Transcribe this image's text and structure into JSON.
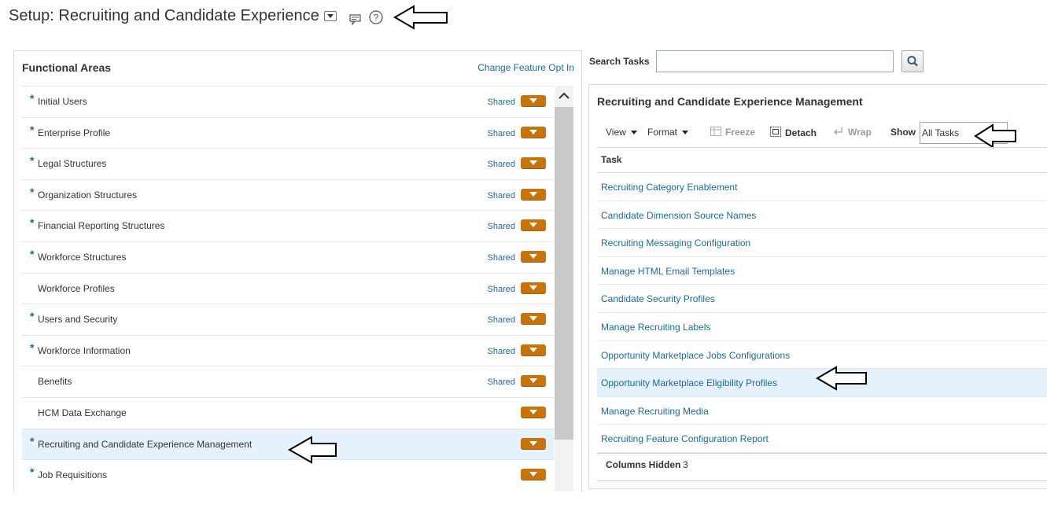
{
  "page": {
    "title": "Setup: Recruiting and Candidate Experience"
  },
  "functional_areas": {
    "heading": "Functional Areas",
    "change_feature_link": "Change Feature Opt In",
    "items": [
      {
        "label": "Initial Users",
        "required": "*",
        "shared": "Shared"
      },
      {
        "label": "Enterprise Profile",
        "required": "*",
        "shared": "Shared"
      },
      {
        "label": "Legal Structures",
        "required": "*",
        "shared": "Shared"
      },
      {
        "label": "Organization Structures",
        "required": "*",
        "shared": "Shared"
      },
      {
        "label": "Financial Reporting Structures",
        "required": "*",
        "shared": "Shared"
      },
      {
        "label": "Workforce Structures",
        "required": "*",
        "shared": "Shared"
      },
      {
        "label": "Workforce Profiles",
        "required": "",
        "shared": "Shared"
      },
      {
        "label": "Users and Security",
        "required": "*",
        "shared": "Shared"
      },
      {
        "label": "Workforce Information",
        "required": "*",
        "shared": "Shared"
      },
      {
        "label": "Benefits",
        "required": "",
        "shared": "Shared"
      },
      {
        "label": "HCM Data Exchange",
        "required": "",
        "shared": ""
      },
      {
        "label": "Recruiting and Candidate Experience Management",
        "required": "*",
        "shared": ""
      },
      {
        "label": "Job Requisitions",
        "required": "*",
        "shared": ""
      }
    ]
  },
  "search": {
    "label": "Search Tasks",
    "value": ""
  },
  "tasks_panel": {
    "title": "Recruiting and Candidate Experience Management",
    "toolbar": {
      "view": "View",
      "format": "Format",
      "freeze": "Freeze",
      "detach": "Detach",
      "wrap": "Wrap",
      "show_label": "Show",
      "show_value": "All Tasks"
    },
    "column_header": "Task",
    "tasks": [
      "Recruiting Category Enablement",
      "Candidate Dimension Source Names",
      "Recruiting Messaging Configuration",
      "Manage HTML Email Templates",
      "Candidate Security Profiles",
      "Manage Recruiting Labels",
      "Opportunity Marketplace Jobs Configurations",
      "Opportunity Marketplace Eligibility Profiles",
      "Manage Recruiting Media",
      "Recruiting Feature Configuration Report"
    ],
    "columns_hidden_label": "Columns Hidden",
    "columns_hidden_value": "3"
  },
  "colors": {
    "link": "#1a6aa0",
    "accent_button": "#c8730c",
    "selected_row": "#e5f1fb"
  },
  "icons": [
    "dropdown-icon",
    "tasks-icon",
    "help-icon",
    "search-icon",
    "freeze-icon",
    "detach-icon",
    "wrap-icon",
    "scroll-up-icon",
    "annotation-arrow-icon"
  ]
}
